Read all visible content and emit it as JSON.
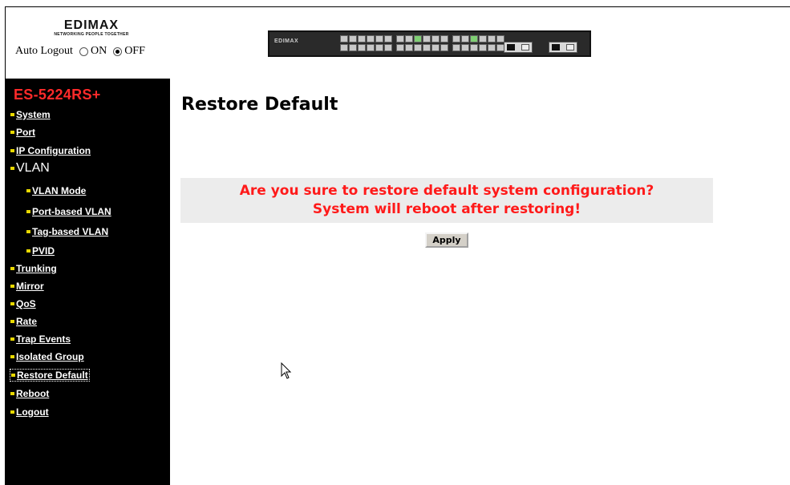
{
  "header": {
    "logo_text": "EDIMAX",
    "logo_tagline": "NETWORKING PEOPLE TOGETHER",
    "auto_logout_label": "Auto Logout",
    "option_on": "ON",
    "option_off": "OFF",
    "auto_logout_value": "OFF",
    "switch_brand": "EDIMAX"
  },
  "sidebar": {
    "model": "ES-5224RS+",
    "items": [
      {
        "label": "System"
      },
      {
        "label": "Port"
      },
      {
        "label": "IP Configuration"
      },
      {
        "label": "VLAN"
      },
      {
        "label": "VLAN Mode"
      },
      {
        "label": "Port-based VLAN"
      },
      {
        "label": "Tag-based VLAN"
      },
      {
        "label": "PVID"
      },
      {
        "label": "Trunking"
      },
      {
        "label": "Mirror"
      },
      {
        "label": "QoS"
      },
      {
        "label": "Rate"
      },
      {
        "label": "Trap Events"
      },
      {
        "label": "Isolated Group"
      },
      {
        "label": "Restore Default"
      },
      {
        "label": "Reboot"
      },
      {
        "label": "Logout"
      }
    ],
    "selected": "Restore Default"
  },
  "main": {
    "title": "Restore Default",
    "message_line1": "Are you sure to restore default system configuration?",
    "message_line2": "System will reboot after restoring!",
    "apply_label": "Apply"
  },
  "colors": {
    "sidebar_bg": "#000000",
    "model_text": "#ff2a2a",
    "warning_text": "#ff1a1a",
    "message_bg": "#ececec",
    "bullet": "#e8d800"
  },
  "icons": {
    "bullet": "yellow-square-bullet-icon",
    "cursor": "mouse-pointer-icon"
  }
}
